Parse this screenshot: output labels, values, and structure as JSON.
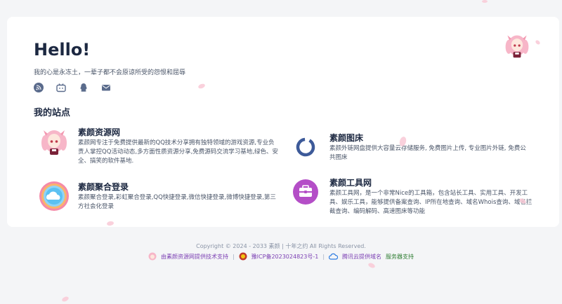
{
  "header": {
    "greeting": "Hello!",
    "motto": "我的心是永冻土，一辈子都不会原谅所受的怨恨和屈辱"
  },
  "socials": [
    "rss-icon",
    "bilibili-icon",
    "qq-icon",
    "mail-icon"
  ],
  "section_title": "我的站点",
  "sites": [
    {
      "name": "素颜资源网",
      "desc": "素颜网专注于免费提供最新的QQ技术分享拥有独特领域的游戏资源,专业负责人掌控QQ活动动态,多方面性质资源分享,免费源码交流学习基地,绿色、安全、搞笑的软件基地.",
      "icon": "anime-avatar-icon"
    },
    {
      "name": "素颜图床",
      "desc": "素颜外链网盘提供大容量云存储服务, 免费图片上传, 专业图片外链, 免费公共图床",
      "icon": "ring-logo-icon"
    },
    {
      "name": "素颜聚合登录",
      "desc": "素颜聚合登录,彩虹聚合登录,QQ快捷登录,微信快捷登录,微博快捷登录,第三方社会化登录",
      "icon": "rainbow-cloud-icon"
    },
    {
      "name": "素颜工具网",
      "desc": "素颜工具网，是一个非常Nice的工具箱，包含站长工具、实用工具、开发工具、娱乐工具，能够提供备案查询、IP所在地查询、域名Whois查询、域名拦截查询、编码解码、高速图床等功能",
      "icon": "toolbox-icon"
    }
  ],
  "footer": {
    "copyright": "Copyright © 2024 - 2033 素颜 | 十年之约 All Rights Reserved.",
    "links": [
      {
        "label": "由素颜资源网提供技术支持",
        "color": "#7b3fb3"
      },
      {
        "label": "豫ICP备2023024823号-1",
        "color": "#7b3fb3"
      },
      {
        "label": "腾讯云提供域名",
        "color": "#7b3fb3"
      },
      {
        "label": "服务器支持",
        "color": "#2e7d32"
      }
    ]
  },
  "colors": {
    "title": "#1c2841",
    "link_purple": "#7b3fb3",
    "link_green": "#2e7d32",
    "petal": "#f9c9d6"
  }
}
